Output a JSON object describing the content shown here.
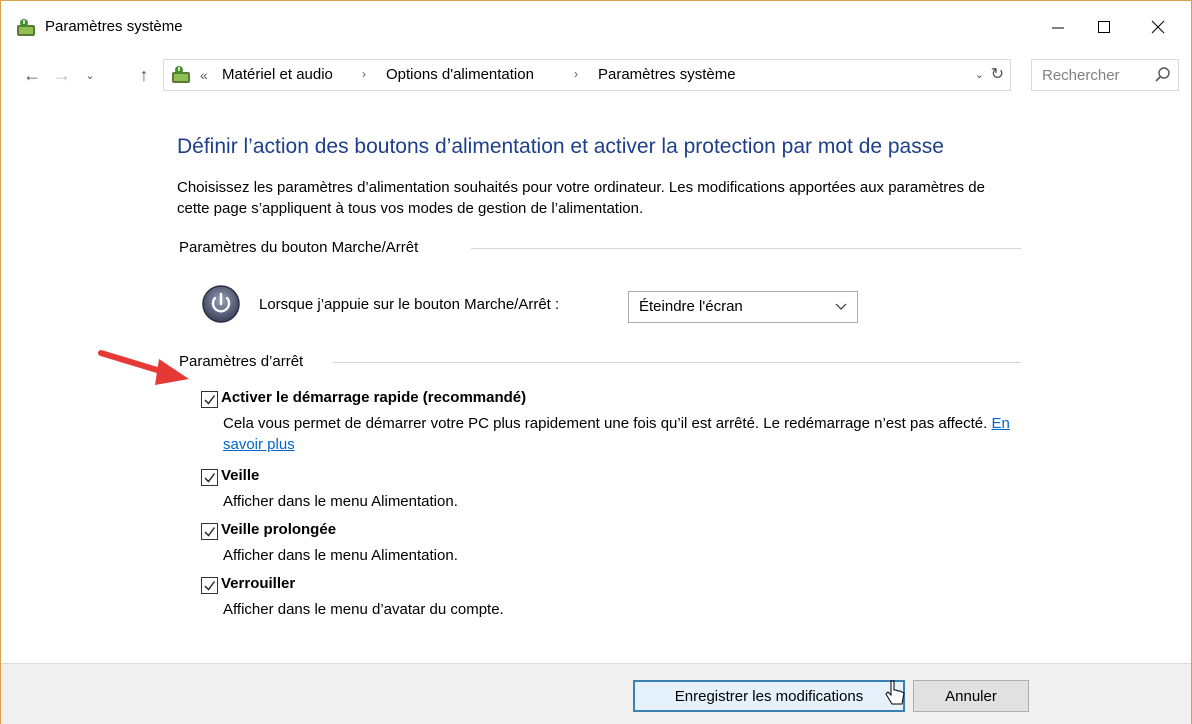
{
  "window": {
    "title": "Paramètres système",
    "controls": {
      "minimize": "—",
      "maximize": "☐",
      "close": "✕"
    }
  },
  "nav": {
    "back": "←",
    "forward": "→",
    "recent": "⌄",
    "up": "↑",
    "overflow": "«",
    "breadcrumbs": [
      "Matériel et audio",
      "Options d'alimentation",
      "Paramètres système"
    ],
    "separator": "›",
    "dropdown": "⌄",
    "refresh": "↻"
  },
  "search": {
    "placeholder": "Rechercher"
  },
  "main": {
    "heading": "Définir l’action des boutons d’alimentation et activer la protection par mot de passe",
    "description": "Choisissez les paramètres d’alimentation souhaités pour votre ordinateur. Les modifications apportées aux paramètres de cette page s’appliquent à tous vos modes de gestion de l’alimentation.",
    "power_group": {
      "label": "Paramètres du bouton Marche/Arrêt",
      "row_label": "Lorsque j’appuie sur le bouton Marche/Arrêt :",
      "selected_option": "Éteindre l'écran"
    },
    "shutdown_group": {
      "label": "Paramètres d’arrêt",
      "items": [
        {
          "label": "Activer le démarrage rapide (recommandé)",
          "checked": true,
          "desc": "Cela vous permet de démarrer votre PC plus rapidement une fois qu’il est arrêté. Le redémarrage n’est pas affecté.",
          "link": "En savoir plus"
        },
        {
          "label": "Veille",
          "checked": true,
          "desc": "Afficher dans le menu Alimentation."
        },
        {
          "label": "Veille prolongée",
          "checked": true,
          "desc": "Afficher dans le menu Alimentation."
        },
        {
          "label": "Verrouiller",
          "checked": true,
          "desc": "Afficher dans le menu d’avatar du compte."
        }
      ]
    }
  },
  "footer": {
    "save_label": "Enregistrer les modifications",
    "cancel_label": "Annuler"
  },
  "colors": {
    "heading": "#1e3f8a",
    "link": "#0066cc",
    "arrow": "#e53935",
    "window_border": "#d8a04a"
  }
}
